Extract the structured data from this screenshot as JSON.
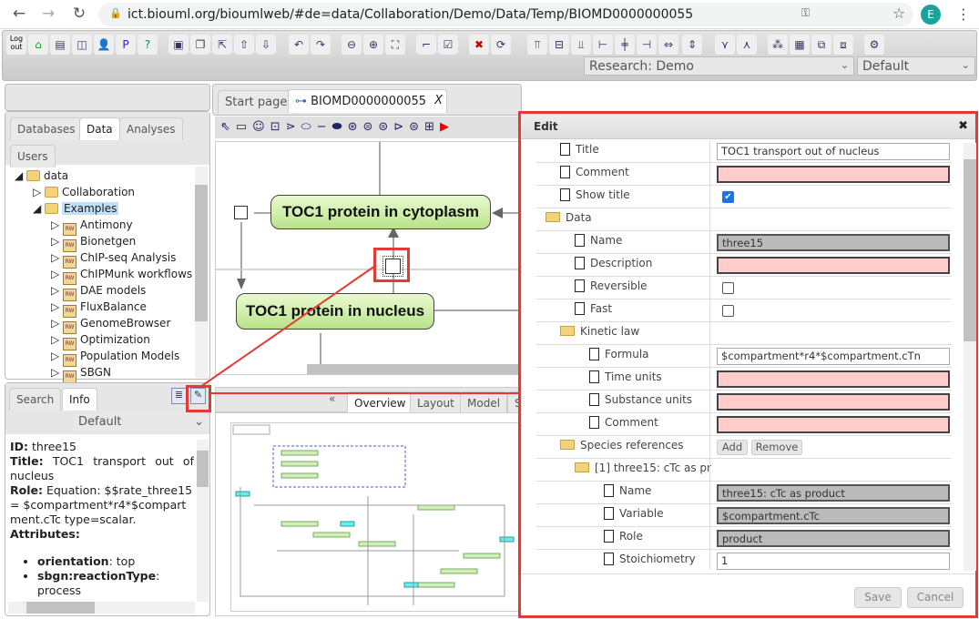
{
  "browser": {
    "url": "ict.biouml.org/bioumlweb/#de=data/Collaboration/Demo/Data/Temp/BIOMD0000000055",
    "avatar": "E"
  },
  "toolbar": {
    "logout": "Log out",
    "p": "P",
    "research_select": "Research: Demo",
    "perspective_select": "Default"
  },
  "left": {
    "tabs": [
      "Databases",
      "Data",
      "Analyses",
      "Users"
    ],
    "active_tab": "Data",
    "tree": [
      {
        "label": "data",
        "type": "folder"
      },
      {
        "label": "Collaboration",
        "type": "folder"
      },
      {
        "label": "Examples",
        "type": "folder",
        "selected": true
      },
      {
        "label": "Antimony",
        "type": "db"
      },
      {
        "label": "Bionetgen",
        "type": "db"
      },
      {
        "label": "ChIP-seq Analysis",
        "type": "db"
      },
      {
        "label": "ChIPMunk workflows",
        "type": "db"
      },
      {
        "label": "DAE models",
        "type": "db"
      },
      {
        "label": "FluxBalance",
        "type": "db"
      },
      {
        "label": "GenomeBrowser",
        "type": "db"
      },
      {
        "label": "Optimization",
        "type": "db"
      },
      {
        "label": "Population Models",
        "type": "db"
      },
      {
        "label": "SBGN",
        "type": "db"
      }
    ]
  },
  "info": {
    "tabs": [
      "Search",
      "Info"
    ],
    "active_tab": "Info",
    "select": "Default",
    "id_label": "ID",
    "id": "three15",
    "title_label": "Title",
    "title": "TOC1 transport out of nucleus",
    "role_label": "Role",
    "role": "Equation: $$rate_three15 = $compartment*r4*$compartment.cTc type=scalar.",
    "attributes_label": "Attributes",
    "attributes": [
      {
        "k": "orientation",
        "v": "top"
      },
      {
        "k": "sbgn:reactionType",
        "v": "process"
      }
    ]
  },
  "editor": {
    "tabs": [
      "Start page",
      "BIOMD0000000055"
    ],
    "active_tab": "BIOMD0000000055",
    "close": "X",
    "nodes": [
      "TOC1 protein in cytoplasm",
      "TOC1 protein in nucleus"
    ],
    "bottom_tabs": [
      "Overview",
      "Layout",
      "Model",
      "S"
    ],
    "active_bottom_tab": "Overview",
    "collapse": "«"
  },
  "edit": {
    "title": "Edit",
    "close": "✖",
    "save": "Save",
    "cancel": "Cancel",
    "add": "Add",
    "remove": "Remove",
    "rows": [
      {
        "label": "Title",
        "level": 1,
        "kind": "text",
        "value": "TOC1 transport out of nucleus"
      },
      {
        "label": "Comment",
        "level": 1,
        "kind": "pink",
        "value": ""
      },
      {
        "label": "Show title",
        "level": 1,
        "kind": "check",
        "checked": true
      },
      {
        "label": "Data",
        "level": 0,
        "kind": "folder"
      },
      {
        "label": "Name",
        "level": 2,
        "kind": "gray",
        "value": "three15"
      },
      {
        "label": "Description",
        "level": 2,
        "kind": "pink",
        "value": ""
      },
      {
        "label": "Reversible",
        "level": 2,
        "kind": "check",
        "checked": false
      },
      {
        "label": "Fast",
        "level": 2,
        "kind": "check",
        "checked": false
      },
      {
        "label": "Kinetic law",
        "level": 1,
        "kind": "folder"
      },
      {
        "label": "Formula",
        "level": 3,
        "kind": "text",
        "value": "$compartment*r4*$compartment.cTn"
      },
      {
        "label": "Time units",
        "level": 3,
        "kind": "pink",
        "value": ""
      },
      {
        "label": "Substance units",
        "level": 3,
        "kind": "pink",
        "value": ""
      },
      {
        "label": "Comment",
        "level": 3,
        "kind": "pink",
        "value": ""
      },
      {
        "label": "Species references",
        "level": 1,
        "kind": "buttons"
      },
      {
        "label": "[1] three15: cTc as pr",
        "level": 2,
        "kind": "folder"
      },
      {
        "label": "Name",
        "level": 4,
        "kind": "gray",
        "value": "three15: cTc as product"
      },
      {
        "label": "Variable",
        "level": 4,
        "kind": "gray",
        "value": "$compartment.cTc"
      },
      {
        "label": "Role",
        "level": 4,
        "kind": "gray",
        "value": "product"
      },
      {
        "label": "Stoichiometry",
        "level": 4,
        "kind": "text",
        "value": "1"
      }
    ]
  },
  "colors": {
    "highlight": "#e53935",
    "node_fill": "#c8eca0",
    "pink": "#ffcccc"
  }
}
